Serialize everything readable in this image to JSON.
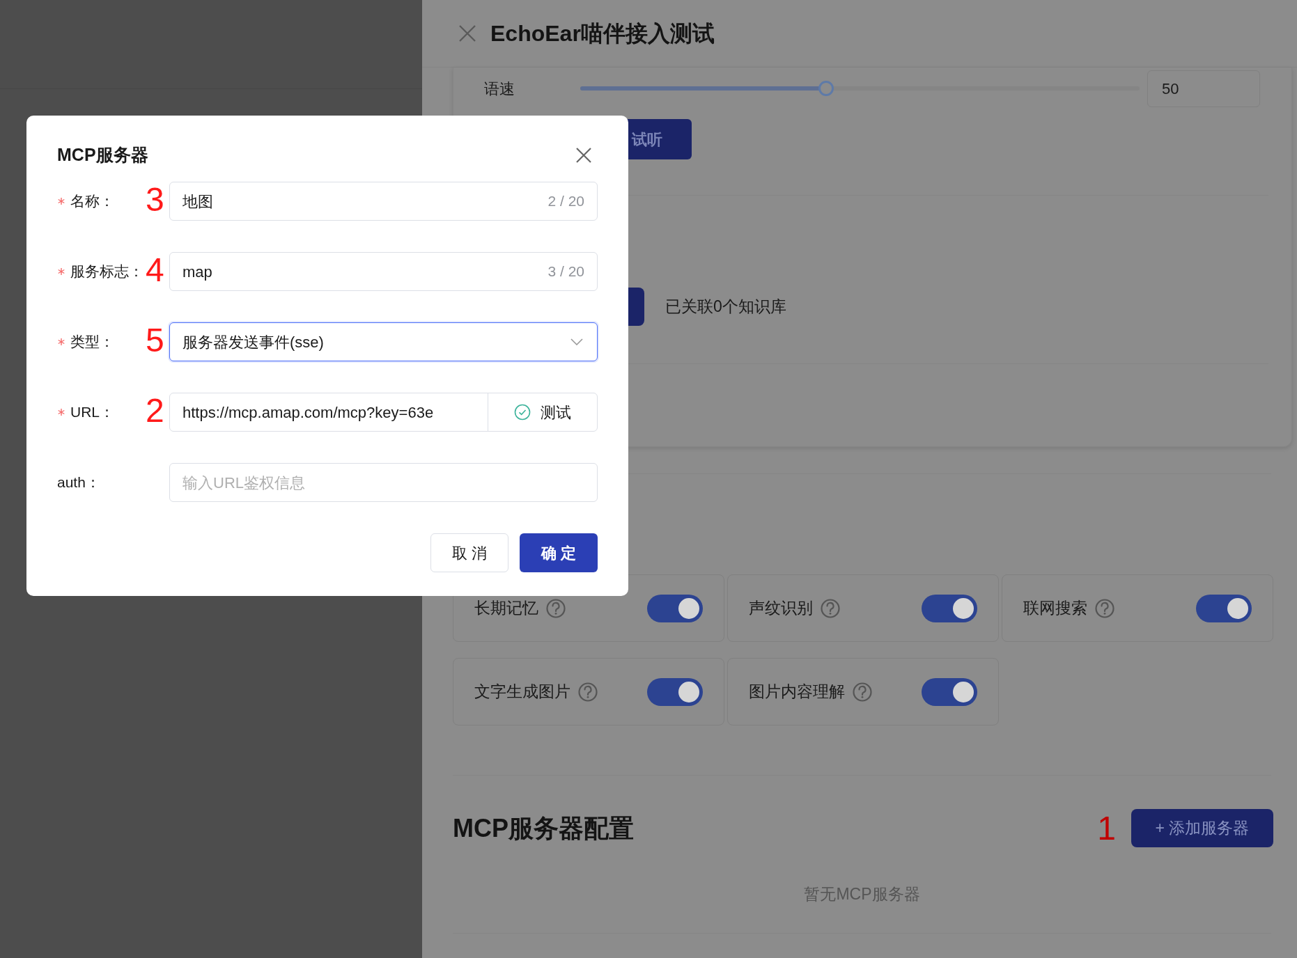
{
  "drawer": {
    "title": "EchoEar喵伴接入测试",
    "speed": {
      "label": "语速",
      "level": 0.44,
      "value": "50"
    },
    "preview_button": "试听",
    "knowledge": "已关联0个知识库",
    "features": [
      {
        "label": "长期记忆",
        "on": true
      },
      {
        "label": "声纹识别",
        "on": true
      },
      {
        "label": "联网搜索",
        "on": true
      },
      {
        "label": "文字生成图片",
        "on": true
      },
      {
        "label": "图片内容理解",
        "on": true
      }
    ],
    "mcp_section": {
      "title": "MCP服务器配置",
      "marker": "1",
      "add_button": "+ 添加服务器",
      "empty": "暂无MCP服务器"
    }
  },
  "dialog": {
    "title": "MCP服务器",
    "fields": [
      {
        "kind": "text",
        "label": "名称：",
        "required": true,
        "marker": "3",
        "value": "地图",
        "counter": "2 / 20"
      },
      {
        "kind": "text",
        "label": "服务标志：",
        "required": true,
        "marker": "4",
        "value": "map",
        "counter": "3 / 20"
      },
      {
        "kind": "select",
        "label": "类型：",
        "required": true,
        "marker": "5",
        "value": "服务器发送事件(sse)",
        "focused": true
      },
      {
        "kind": "url",
        "label": "URL：",
        "required": true,
        "marker": "2",
        "value": "https://mcp.amap.com/mcp?key=63e",
        "test_button": "测试"
      },
      {
        "kind": "text",
        "label": "auth：",
        "required": false,
        "placeholder": "输入URL鉴权信息"
      }
    ],
    "buttons": [
      {
        "label": "取 消",
        "primary": false
      },
      {
        "label": "确 定",
        "primary": true
      }
    ]
  }
}
